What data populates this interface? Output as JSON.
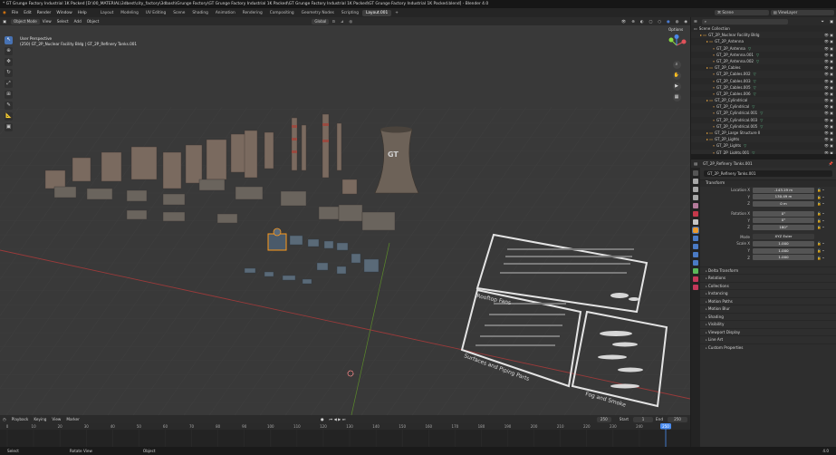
{
  "window": {
    "title": "* GT Grunge Factory Industrial 1K Packed [D:\\00_MATERIAL\\3dbest\\city_factory\\3dbash\\Grunge Factory\\GT Grunge Factory Industrial 1K Packed\\GT Grunge Factory Industrial 1K Packed\\GT Grunge Factory Industrial 1K Packed.blend] - Blender 4.0"
  },
  "menubar": {
    "items": [
      "File",
      "Edit",
      "Render",
      "Window",
      "Help"
    ],
    "workspaces": [
      "Layout",
      "Modeling",
      "UV Editing",
      "Scene",
      "Shading",
      "Animation",
      "Rendering",
      "Compositing",
      "Geometry Nodes",
      "Scripting",
      "Layout.001",
      "+"
    ],
    "active_workspace": "Layout.001",
    "scene": "Scene",
    "view_layer": "ViewLayer"
  },
  "viewport_header": {
    "mode": "Object Mode",
    "menus": [
      "View",
      "Select",
      "Add",
      "Object"
    ],
    "orientation": "Global",
    "options": "Options"
  },
  "viewport": {
    "perspective": "User Perspective",
    "collection_info": "(250) GT_2P_Nuclear Facility Bldg | GT_2P_Refinery Tanks.001",
    "tools": [
      "Select Box",
      "Cursor",
      "Move",
      "Rotate",
      "Scale",
      "Transform",
      "Annotate",
      "Measure",
      "Add Cube"
    ],
    "active_tool": "Select Box",
    "sign_text_1": "Rooftop Fans",
    "sign_text_2": "Surfaces and Piping Parts",
    "sign_text_3": "Fog and Smoke",
    "tower_label": "GT"
  },
  "timeline": {
    "menus": [
      "Playback",
      "Keying",
      "View",
      "Marker"
    ],
    "current_frame": "250",
    "start_label": "Start",
    "start": "1",
    "end_label": "End",
    "end": "250",
    "ticks": [
      "0",
      "10",
      "20",
      "30",
      "40",
      "50",
      "60",
      "70",
      "80",
      "90",
      "100",
      "110",
      "120",
      "130",
      "140",
      "150",
      "160",
      "170",
      "180",
      "190",
      "200",
      "210",
      "220",
      "230",
      "240",
      "250"
    ],
    "playhead": "250"
  },
  "statusbar": {
    "select": "Select",
    "rotate": "Rotate View",
    "object": "Object",
    "version": "4.0"
  },
  "outliner": {
    "search_placeholder": "",
    "rows": [
      {
        "indent": 0,
        "kind": "scene",
        "label": "Scene Collection",
        "filter": ""
      },
      {
        "indent": 1,
        "kind": "col",
        "label": "GT_2P_Nuclear Facility Bldg",
        "filter": ""
      },
      {
        "indent": 2,
        "kind": "col",
        "label": "GT_2P_Antenna",
        "filter": ""
      },
      {
        "indent": 3,
        "kind": "obj",
        "label": "GT_2P_Antenna",
        "filter": "▽"
      },
      {
        "indent": 3,
        "kind": "obj",
        "label": "GT_2P_Antenna.001",
        "filter": "▽"
      },
      {
        "indent": 3,
        "kind": "obj",
        "label": "GT_2P_Antenna.002",
        "filter": "▽"
      },
      {
        "indent": 2,
        "kind": "col",
        "label": "GT_2P_Cables",
        "filter": ""
      },
      {
        "indent": 3,
        "kind": "obj",
        "label": "GT_2P_Cables.002",
        "filter": "▽"
      },
      {
        "indent": 3,
        "kind": "obj",
        "label": "GT_2P_Cables.003",
        "filter": "▽"
      },
      {
        "indent": 3,
        "kind": "obj",
        "label": "GT_2P_Cables.005",
        "filter": "▽"
      },
      {
        "indent": 3,
        "kind": "obj",
        "label": "GT_2P_Cables.006",
        "filter": "▽"
      },
      {
        "indent": 2,
        "kind": "col",
        "label": "GT_2P_Cylindrical",
        "filter": ""
      },
      {
        "indent": 3,
        "kind": "obj",
        "label": "GT_2P_Cylindrical",
        "filter": "▽"
      },
      {
        "indent": 3,
        "kind": "obj",
        "label": "GT_2P_Cylindrical.001",
        "filter": "▽"
      },
      {
        "indent": 3,
        "kind": "obj",
        "label": "GT_2P_Cylindrical.003",
        "filter": "▽"
      },
      {
        "indent": 3,
        "kind": "obj",
        "label": "GT_2P_Cylindrical.005",
        "filter": "▽"
      },
      {
        "indent": 2,
        "kind": "col",
        "label": "GT_2P_Large Structure II",
        "filter": ""
      },
      {
        "indent": 2,
        "kind": "col",
        "label": "GT_2P_Lights",
        "filter": ""
      },
      {
        "indent": 3,
        "kind": "obj",
        "label": "GT_2P_Lights",
        "filter": "▽"
      },
      {
        "indent": 3,
        "kind": "obj",
        "label": "GT_2P_Lights.001",
        "filter": "▽"
      }
    ]
  },
  "properties": {
    "breadcrumb": "GT_2P_Refinery Tanks.001",
    "object_name": "GT_2P_Refinery Tanks.001",
    "transform_header": "Transform",
    "location": [
      {
        "axis": "Location X",
        "value": "-143.19 m"
      },
      {
        "axis": "Y",
        "value": "130.49 m"
      },
      {
        "axis": "Z",
        "value": "0 m"
      }
    ],
    "rotation": [
      {
        "axis": "Rotation X",
        "value": "0°"
      },
      {
        "axis": "Y",
        "value": "0°"
      },
      {
        "axis": "Z",
        "value": "180°"
      }
    ],
    "mode_label": "Mode",
    "mode_value": "XYZ Euler",
    "scale": [
      {
        "axis": "Scale X",
        "value": "1.000"
      },
      {
        "axis": "Y",
        "value": "1.000"
      },
      {
        "axis": "Z",
        "value": "1.000"
      }
    ],
    "sections": [
      "Delta Transform",
      "Relations",
      "Collections",
      "Instancing",
      "Motion Paths",
      "Motion Blur",
      "Shading",
      "Visibility",
      "Viewport Display",
      "Line Art",
      "Custom Properties"
    ]
  }
}
